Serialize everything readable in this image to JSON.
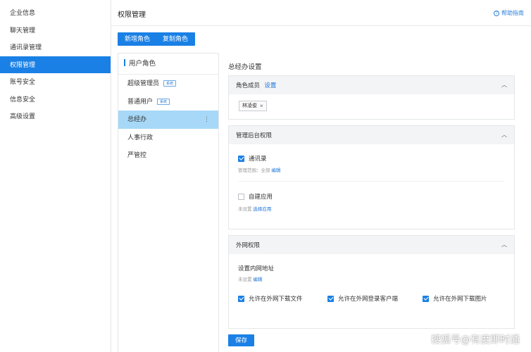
{
  "sidebar": {
    "items": [
      {
        "label": "企业信息"
      },
      {
        "label": "聊天管理"
      },
      {
        "label": "通讯录管理"
      },
      {
        "label": "权限管理"
      },
      {
        "label": "账号安全"
      },
      {
        "label": "信息安全"
      },
      {
        "label": "高级设置"
      }
    ],
    "active_index": 3
  },
  "header": {
    "title": "权限管理",
    "help_label": "帮助指南",
    "help_icon": "question-circle-icon"
  },
  "toolbar": {
    "add_role_label": "新增角色",
    "copy_role_label": "复制角色"
  },
  "roles": {
    "title": "用户角色",
    "items": [
      {
        "label": "超级管理员",
        "tag": "系统"
      },
      {
        "label": "普通用户",
        "tag": "系统"
      },
      {
        "label": "总经办"
      },
      {
        "label": "人事行政"
      },
      {
        "label": "严管控"
      }
    ],
    "active_index": 2,
    "more_icon": "⋮"
  },
  "settings": {
    "title": "总经办设置",
    "members": {
      "title": "角色成员",
      "setting_link": "设置",
      "chips": [
        "林凌俊"
      ],
      "chip_close": "×"
    },
    "admin": {
      "title": "管理后台权限",
      "contacts": {
        "label": "通讯录",
        "checked": true,
        "scope_label": "管理范围：全部",
        "edit_link": "编辑"
      },
      "custom_app": {
        "label": "自建应用",
        "checked": false,
        "status": "未设置",
        "select_link": "选择应用"
      }
    },
    "external": {
      "title": "外网权限",
      "intranet_label": "设置内网地址",
      "intranet_status": "未设置",
      "intranet_edit_link": "编辑",
      "options": [
        {
          "label": "允许在外网下载文件",
          "checked": true
        },
        {
          "label": "允许在外网登录客户端",
          "checked": true
        },
        {
          "label": "允许在外网下载图片",
          "checked": true
        }
      ]
    },
    "save_label": "保存"
  },
  "watermark": "搜狐号@有度即时通",
  "colors": {
    "accent": "#1a80e5",
    "active_role_bg": "#a7d8f7"
  }
}
